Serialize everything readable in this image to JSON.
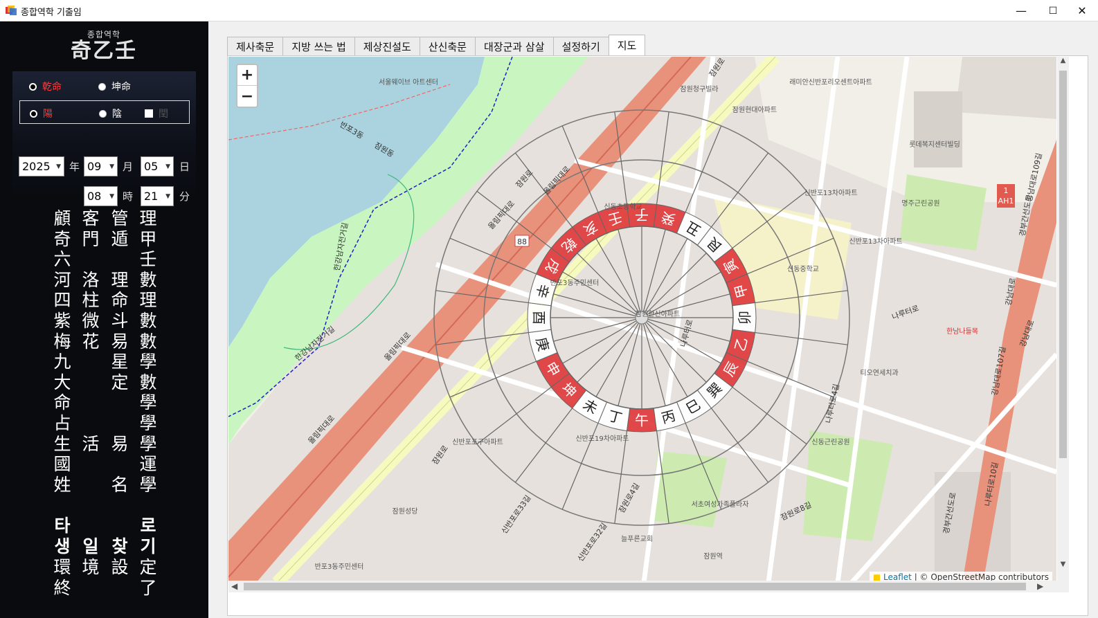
{
  "window": {
    "title": "종합역학 기출임",
    "minimize": "—",
    "maximize": "☐",
    "close": "✕"
  },
  "logo": {
    "small": "종합역학",
    "big": "奇乙壬"
  },
  "gender": {
    "male": "乾命",
    "female": "坤命"
  },
  "yinyang": {
    "yang": "陽",
    "yin": "陰",
    "leap": "閏"
  },
  "date": {
    "year": "2025",
    "year_unit": "年",
    "month": "09",
    "month_unit": "月",
    "day": "05",
    "day_unit": "日",
    "hour": "08",
    "hour_unit": "時",
    "minute": "21",
    "minute_unit": "分"
  },
  "menu": {
    "col1": [
      "顧",
      "奇",
      "六",
      "河",
      "四",
      "紫",
      "梅",
      "九",
      "大",
      "命",
      "占",
      "生",
      "國",
      "姓"
    ],
    "col2": [
      "客",
      "門",
      "",
      "洛",
      "柱",
      "微",
      "花",
      "",
      "",
      "",
      "",
      "活",
      "",
      "",
      ""
    ],
    "col3": [
      "管",
      "遁",
      "",
      "理",
      "命",
      "斗",
      "易",
      "星",
      "定",
      "",
      "",
      "易",
      "",
      "名"
    ],
    "col4": [
      "理",
      "甲",
      "壬",
      "數",
      "理",
      "數",
      "數",
      "學",
      "數",
      "學",
      "學",
      "學",
      "運",
      "學"
    ],
    "bottom": {
      "c1": [
        "타",
        "생",
        "環",
        "終"
      ],
      "c2": [
        "",
        "일",
        "境",
        ""
      ],
      "c3": [
        "",
        "찾",
        "設",
        ""
      ],
      "c4": [
        "로",
        "기",
        "定",
        "了"
      ]
    }
  },
  "tabs": [
    "제사축문",
    "지방 쓰는 법",
    "제상진설도",
    "산신축문",
    "대장군과 삼살",
    "설정하기",
    "지도"
  ],
  "active_tab": "지도",
  "map": {
    "zoom_in": "+",
    "zoom_out": "−",
    "attribution_leaflet": "Leaflet",
    "attribution_rest": " | © OpenStreetMap contributors",
    "compass_inner": [
      "午",
      "丁",
      "未",
      "坤",
      "申",
      "庚",
      "酉",
      "辛",
      "戌",
      "乾",
      "亥",
      "壬",
      "子",
      "癸",
      "丑",
      "艮",
      "寅",
      "甲",
      "卯",
      "乙",
      "辰",
      "巽",
      "巳",
      "丙"
    ],
    "compass_red": [
      "午",
      "坤",
      "申",
      "戌",
      "乾",
      "亥",
      "壬",
      "子",
      "癸",
      "寅",
      "甲",
      "乙",
      "辰"
    ],
    "road_labels": [
      "올림픽대로",
      "올림픽대로",
      "올림픽대로",
      "올림픽대로",
      "잠원로",
      "잠원로",
      "잠원로",
      "나루터로",
      "나루터로4길",
      "강남대로",
      "경부간선도로",
      "경부간선도로",
      "강남대로109길",
      "신반포로33길",
      "신반포로32길",
      "잠원로4길",
      "잠원로8길",
      "한강남자전거길",
      "한강남자전거길",
      "반포3동",
      "잠원동",
      "나루터로",
      "나루터로10길",
      "강남대로",
      "강남대로107길"
    ],
    "poi_labels": [
      "서울웨이브 아트센터",
      "잠원청구빌라",
      "잠원현대아파트",
      "래미안신반포리오센트아파트",
      "신반포13차아파트",
      "신동중학교",
      "신반포13차아파트",
      "신동초등학교",
      "잠원한신아파트",
      "반포3동주민센터",
      "잠원역",
      "잠원성당",
      "한남나들목",
      "명주근린공원",
      "롯데복지센터빌딩",
      "신반포19차아파트",
      "신동근린공원",
      "티오연세치과",
      "늘푸른교회",
      "서초여성가족플라자",
      "반포3동주민센터",
      "신반포포구아파트"
    ],
    "highway_shield": "88",
    "ah_shield_top": "1",
    "ah_shield_bottom": "AH1"
  }
}
